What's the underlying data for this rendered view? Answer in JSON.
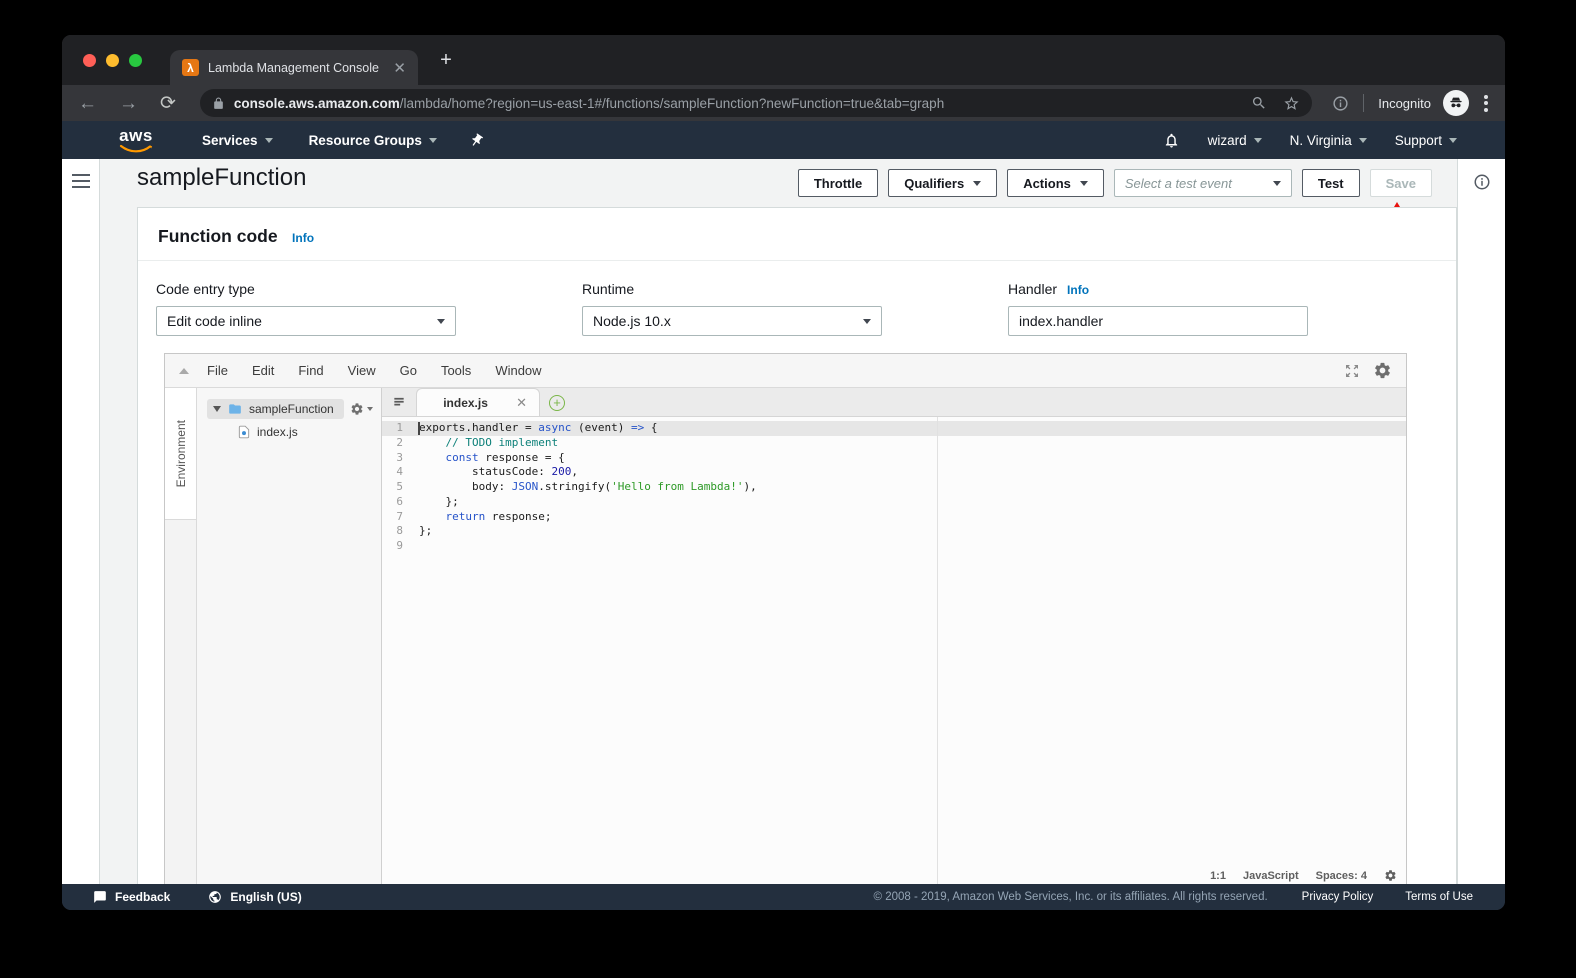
{
  "browser": {
    "tab_title": "Lambda Management Console",
    "url_host": "console.aws.amazon.com",
    "url_path": "/lambda/home?region=us-east-1#/functions/sampleFunction?newFunction=true&tab=graph",
    "incognito_label": "Incognito"
  },
  "aws_nav": {
    "services": "Services",
    "resource_groups": "Resource Groups",
    "user": "wizard",
    "region": "N. Virginia",
    "support": "Support"
  },
  "page": {
    "title": "sampleFunction",
    "throttle": "Throttle",
    "qualifiers": "Qualifiers",
    "actions": "Actions",
    "test_event_placeholder": "Select a test event",
    "test": "Test",
    "save": "Save"
  },
  "function_code": {
    "heading": "Function code",
    "info": "Info",
    "code_entry_label": "Code entry type",
    "code_entry_value": "Edit code inline",
    "runtime_label": "Runtime",
    "runtime_value": "Node.js 10.x",
    "handler_label": "Handler",
    "handler_info": "Info",
    "handler_value": "index.handler"
  },
  "editor": {
    "menus": [
      "File",
      "Edit",
      "Find",
      "View",
      "Go",
      "Tools",
      "Window"
    ],
    "environment_label": "Environment",
    "folder_name": "sampleFunction",
    "file_name": "index.js",
    "tab_name": "index.js",
    "status_cursor": "1:1",
    "status_language": "JavaScript",
    "status_spaces": "Spaces: 4",
    "code_lines": [
      {
        "num": 1,
        "segs": [
          {
            "t": "exports.handler = ",
            "c": "p"
          },
          {
            "t": "async",
            "c": "k"
          },
          {
            "t": " (event) ",
            "c": "p"
          },
          {
            "t": "=>",
            "c": "k"
          },
          {
            "t": " {",
            "c": "p"
          }
        ]
      },
      {
        "num": 2,
        "segs": [
          {
            "t": "    ",
            "c": "p"
          },
          {
            "t": "// TODO implement",
            "c": "c"
          }
        ]
      },
      {
        "num": 3,
        "segs": [
          {
            "t": "    ",
            "c": "p"
          },
          {
            "t": "const",
            "c": "k"
          },
          {
            "t": " response = {",
            "c": "p"
          }
        ]
      },
      {
        "num": 4,
        "segs": [
          {
            "t": "        statusCode: ",
            "c": "p"
          },
          {
            "t": "200",
            "c": "n"
          },
          {
            "t": ",",
            "c": "p"
          }
        ]
      },
      {
        "num": 5,
        "segs": [
          {
            "t": "        body: ",
            "c": "p"
          },
          {
            "t": "JSON",
            "c": "k"
          },
          {
            "t": ".stringify(",
            "c": "p"
          },
          {
            "t": "'Hello from Lambda!'",
            "c": "s"
          },
          {
            "t": "),",
            "c": "p"
          }
        ]
      },
      {
        "num": 6,
        "segs": [
          {
            "t": "    };",
            "c": "p"
          }
        ]
      },
      {
        "num": 7,
        "segs": [
          {
            "t": "    ",
            "c": "p"
          },
          {
            "t": "return",
            "c": "k"
          },
          {
            "t": " response;",
            "c": "p"
          }
        ]
      },
      {
        "num": 8,
        "segs": [
          {
            "t": "};",
            "c": "p"
          }
        ]
      },
      {
        "num": 9,
        "segs": []
      }
    ]
  },
  "footer": {
    "feedback": "Feedback",
    "language": "English (US)",
    "copyright": "© 2008 - 2019, Amazon Web Services, Inc. or its affiliates. All rights reserved.",
    "privacy": "Privacy Policy",
    "terms": "Terms of Use"
  },
  "colors": {
    "aws_orange": "#ec7211",
    "aws_navy": "#232f3e",
    "link_blue": "#0073bb",
    "arrow_red": "#e8120f",
    "keyword_blue": "#2653c9",
    "string_green": "#2d9926",
    "comment_teal": "#0d8079",
    "number_navy": "#1a1aa6"
  }
}
